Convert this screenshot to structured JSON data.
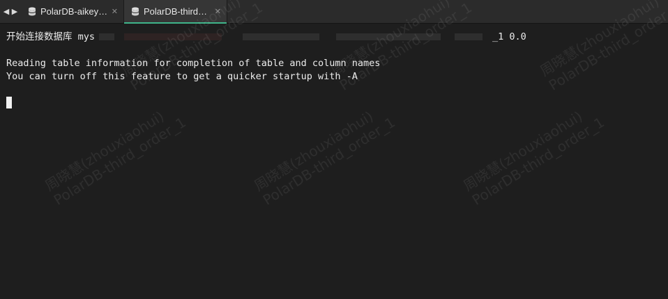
{
  "tabs": [
    {
      "label": "PolarDB-aikey…",
      "icon": "database-icon",
      "active": false
    },
    {
      "label": "PolarDB-third…",
      "icon": "database-icon",
      "active": true
    }
  ],
  "terminal": {
    "connect_prefix": "开始连接数据库 mys",
    "connect_suffix": "_1 0.0",
    "line2": "Reading table information for completion of table and column names",
    "line3": "You can turn off this feature to get a quicker startup with -A"
  },
  "watermark": {
    "name": "周晓慧(zhouxiaohui)",
    "db": "PolarDB-third_order_1"
  },
  "colors": {
    "background": "#1e1e1e",
    "tab_bar": "#2b2b2b",
    "active_tab_indicator": "#3fb58a",
    "text": "#ececec"
  }
}
